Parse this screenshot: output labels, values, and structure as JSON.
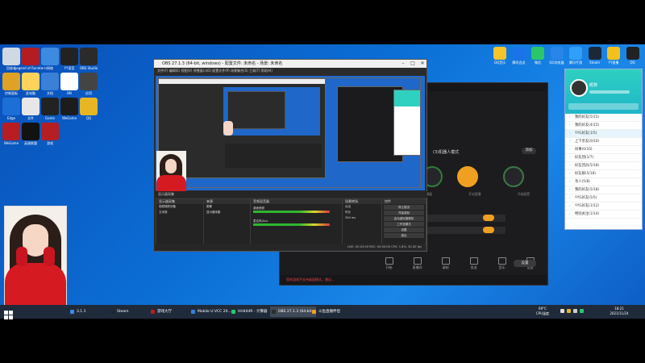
{
  "desktop_icons_left": [
    {
      "label": "回收站",
      "color": "#cfd8e3",
      "icon": "recycle-bin-icon"
    },
    {
      "label": "Legend of Runeterra",
      "color": "#b21c22",
      "icon": "game-icon"
    },
    {
      "label": "网络",
      "color": "#3d8be0",
      "icon": "network-icon"
    },
    {
      "label": "YY语音",
      "color": "#222",
      "icon": "yy-icon"
    },
    {
      "label": "OBS Studio",
      "color": "#2b2b2b",
      "icon": "obs-icon"
    },
    {
      "label": "控制面板",
      "color": "#e0a226",
      "icon": "folder-icon"
    },
    {
      "label": "此电脑",
      "color": "#ffd35a",
      "icon": "document-icon"
    },
    {
      "label": "文档",
      "color": "#3a7fd8",
      "icon": "computer-icon"
    },
    {
      "label": "BN",
      "color": "#fff",
      "icon": "bn-icon"
    },
    {
      "label": "应用",
      "color": "#444",
      "icon": "app-icon"
    },
    {
      "label": "Edge",
      "color": "#1c6fd6",
      "icon": "edge-icon"
    },
    {
      "label": "文件",
      "color": "#e7e7e7",
      "icon": "file-icon"
    },
    {
      "label": "Game",
      "color": "#222",
      "icon": "game-dark-icon"
    },
    {
      "label": "WeGame",
      "color": "#1c1c1c",
      "icon": "wegame-icon"
    },
    {
      "label": "QQ",
      "color": "#e7b622",
      "icon": "qq-icon"
    },
    {
      "label": "WeGame",
      "color": "#b81d22",
      "icon": "wegame-red-icon"
    },
    {
      "label": "英雄联盟",
      "color": "#121212",
      "icon": "lol-icon"
    },
    {
      "label": "游戏",
      "color": "#b51e22",
      "icon": "game-red-icon"
    }
  ],
  "desktop_icons_right": [
    {
      "label": "QQ音乐",
      "color": "#f8c42c",
      "icon": "music-icon"
    },
    {
      "label": "腾讯会议",
      "color": "#1a73e8",
      "icon": "meeting-icon"
    },
    {
      "label": "微信",
      "color": "#2ac76a",
      "icon": "wechat-icon"
    },
    {
      "label": "QQ浏览器",
      "color": "#2a85e8",
      "icon": "browser-icon"
    },
    {
      "label": "腾讯手游",
      "color": "#2f9ff8",
      "icon": "phone-icon"
    },
    {
      "label": "Steam",
      "color": "#1b2838",
      "icon": "steam-icon"
    },
    {
      "label": "YY直播",
      "color": "#f3c21a",
      "icon": "yy-live-icon"
    },
    {
      "label": "QQ",
      "color": "#222",
      "icon": "qq-penguin-icon"
    }
  ],
  "obs": {
    "title": "OBS 27.1.3 (64-bit, windows) - 配置文件: 未命名 - 场景: 未命名",
    "menu": "文件(F)   编辑(E)   视图(V)   停靠窗口(D)   配置文件(P)   场景集合(S)   工具(T)   帮助(H)",
    "scenes_header": "显示器采集",
    "scene_items": [
      "视频捕获设备",
      "文本框"
    ],
    "sources_header": "来源",
    "source_items": [
      "图像",
      "显示器采集"
    ],
    "mixer_header": "音频混音器",
    "mixer_labels": [
      "桌面音频",
      "麦克风/Aux"
    ],
    "transition_header": "场景转场",
    "transition_items": [
      "淡出",
      "时长"
    ],
    "transition_value": "300 ms",
    "controls_header": "控件",
    "controls": [
      "停止推流",
      "开始录制",
      "启动虚拟摄像机",
      "工作室模式",
      "设置",
      "退出"
    ],
    "status": "LIVE: 00:03:09   REC: 00:00:00   CPU: 1.8%, 30.00 fps"
  },
  "app": {
    "mode_label": "(3)机器人模式",
    "action_button": "添加",
    "circles": [
      "开始",
      "音频",
      "开始配置"
    ],
    "captions": [
      "显示直播器",
      "开启直播",
      "开始配置"
    ],
    "notice": "您的游戏不支持桌面模式，建议...",
    "bottom_buttons": [
      "开始",
      "直播间",
      "录制",
      "发送",
      "音乐",
      "设置"
    ],
    "settings_button": "设置"
  },
  "qq": {
    "username": "昵称",
    "groups": [
      "我的好友(5/15)",
      "我的好友(4/15)",
      "YYG好友(1/5)",
      "上下亲友(0/10)",
      "同事(0/10)",
      "好友团(1/7)",
      "好友团员(5/18)",
      "好友群(5/18)",
      "亲人(5/8)",
      "我的好友(5/18)",
      "YYG好友(5/5)",
      "YYG好友(1/12)",
      "特别关注(1/14)"
    ]
  },
  "taskbar": {
    "items": [
      {
        "label": "3.1.1",
        "color": "#3c8be8"
      },
      {
        "label": "Steam",
        "color": "#1b2838"
      },
      {
        "label": "游戏大厅",
        "color": "#b81d22"
      },
      {
        "label": "Mobile U VCC 20...",
        "color": "#3a7fd8"
      },
      {
        "label": "HH444R - 计算器",
        "color": "#2ac76a"
      },
      {
        "label": "OBS 27.1.3 (64-bit...",
        "color": "#2b2b2b"
      },
      {
        "label": "斗鱼直播伴侣",
        "color": "#f0a020"
      }
    ],
    "tray_temp": "69°C",
    "tray_label": "CPU温度",
    "time": "18:21",
    "date": "2021/11/24"
  }
}
